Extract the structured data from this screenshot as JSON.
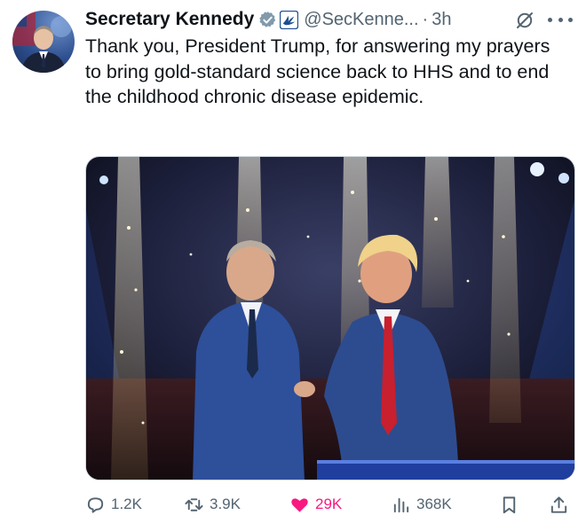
{
  "author": {
    "name": "Secretary Kennedy",
    "handle": "@SecKenne...",
    "separator": "·",
    "time": "3h"
  },
  "tweet": {
    "text": "Thank you, President Trump, for answering my prayers to bring gold-standard science back to HHS and to end the childhood chronic disease epidemic."
  },
  "actions": {
    "replies": "1.2K",
    "reposts": "3.9K",
    "likes": "29K",
    "views": "368K"
  },
  "colors": {
    "verified": "#829aab",
    "like": "#f91880",
    "secondary_text": "#536471"
  },
  "icons": {
    "verified": "verified-badge-icon",
    "org": "hhs-eagle-icon",
    "grok": "grok-icon",
    "more": "more-icon",
    "reply": "reply-icon",
    "repost": "repost-icon",
    "like": "heart-icon",
    "views": "views-icon",
    "bookmark": "bookmark-icon",
    "share": "share-icon"
  }
}
